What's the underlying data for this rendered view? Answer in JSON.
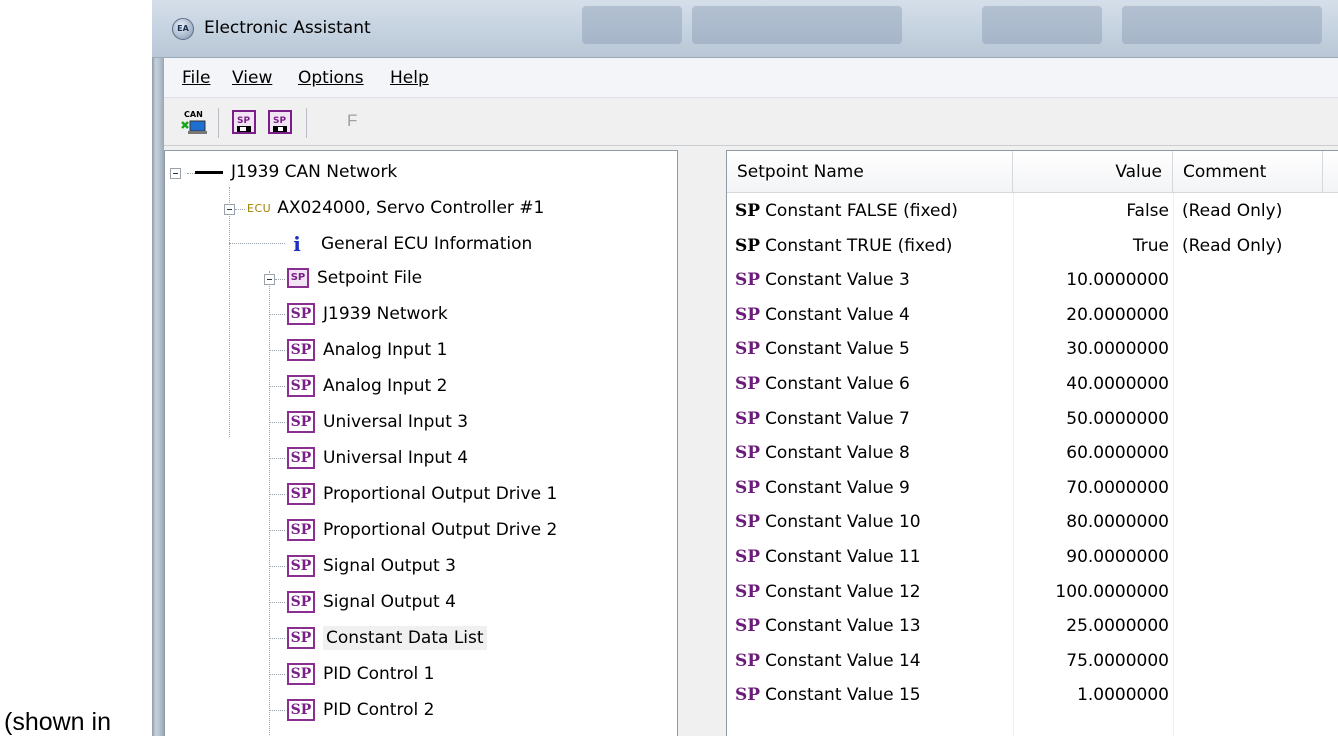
{
  "caption": "(shown in",
  "window": {
    "title": "Electronic Assistant",
    "app_icon_text": "EA"
  },
  "menu": {
    "file": "File",
    "view": "View",
    "options": "Options",
    "help": "Help"
  },
  "toolbar": {
    "can_icon_text": "CAN",
    "sp_icon_text": "SP",
    "f_label": "F"
  },
  "tree": {
    "network": "J1939 CAN Network",
    "ecu_tag": "ECU",
    "ecu": "AX024000, Servo Controller #1",
    "info_glyph": "i",
    "info": "General ECU Information",
    "setpoint_file_icon": "SP",
    "setpoint_file": "Setpoint File",
    "sp_glyph": "SP",
    "items": [
      "J1939 Network",
      "Analog Input 1",
      "Analog Input 2",
      "Universal Input 3",
      "Universal Input 4",
      "Proportional Output Drive 1",
      "Proportional Output Drive 2",
      "Signal Output 3",
      "Signal Output 4",
      "Constant Data List",
      "PID Control 1",
      "PID Control 2"
    ],
    "selected": "Constant Data List"
  },
  "list": {
    "headers": {
      "name": "Setpoint Name",
      "value": "Value",
      "comment": "Comment"
    },
    "sp_glyph": "SP",
    "rows": [
      {
        "name": "Constant FALSE (fixed)",
        "value": "False",
        "comment": "(Read Only)",
        "fixed": true
      },
      {
        "name": "Constant TRUE (fixed)",
        "value": "True",
        "comment": "(Read Only)",
        "fixed": true
      },
      {
        "name": "Constant Value 3",
        "value": "10.0000000",
        "comment": "",
        "fixed": false
      },
      {
        "name": "Constant Value 4",
        "value": "20.0000000",
        "comment": "",
        "fixed": false
      },
      {
        "name": "Constant Value 5",
        "value": "30.0000000",
        "comment": "",
        "fixed": false
      },
      {
        "name": "Constant Value 6",
        "value": "40.0000000",
        "comment": "",
        "fixed": false
      },
      {
        "name": "Constant Value 7",
        "value": "50.0000000",
        "comment": "",
        "fixed": false
      },
      {
        "name": "Constant Value 8",
        "value": "60.0000000",
        "comment": "",
        "fixed": false
      },
      {
        "name": "Constant Value 9",
        "value": "70.0000000",
        "comment": "",
        "fixed": false
      },
      {
        "name": "Constant Value 10",
        "value": "80.0000000",
        "comment": "",
        "fixed": false
      },
      {
        "name": "Constant Value 11",
        "value": "90.0000000",
        "comment": "",
        "fixed": false
      },
      {
        "name": "Constant Value 12",
        "value": "100.0000000",
        "comment": "",
        "fixed": false
      },
      {
        "name": "Constant Value 13",
        "value": "25.0000000",
        "comment": "",
        "fixed": false
      },
      {
        "name": "Constant Value 14",
        "value": "75.0000000",
        "comment": "",
        "fixed": false
      },
      {
        "name": "Constant Value 15",
        "value": "1.0000000",
        "comment": "",
        "fixed": false
      }
    ]
  },
  "colors": {
    "sp_purple": "#6b1b7a",
    "info_blue": "#1c2fbf",
    "ecu_gold": "#a18100"
  }
}
